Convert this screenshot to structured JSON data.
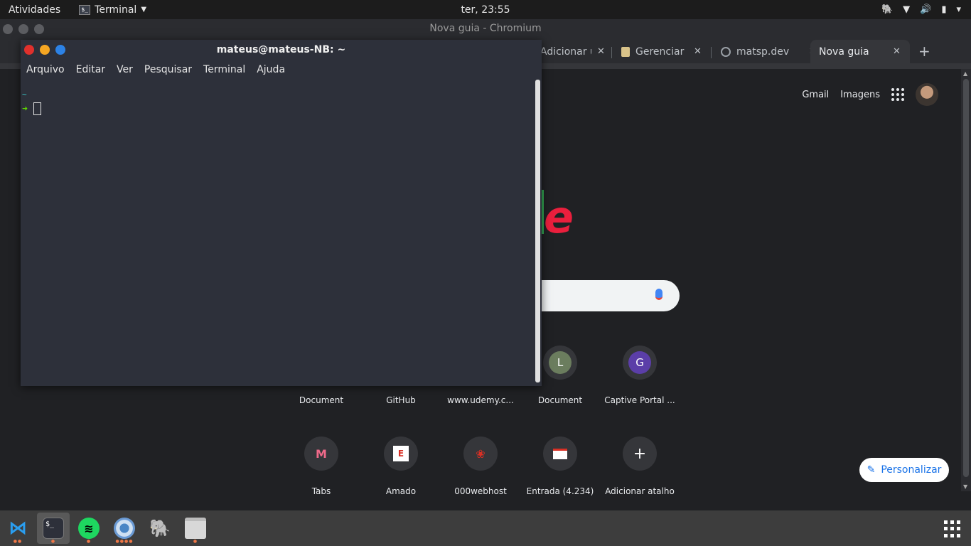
{
  "topbar": {
    "activities": "Atividades",
    "app_menu": "Terminal",
    "clock": "ter, 23:55"
  },
  "browser": {
    "window_title": "Nova guia - Chromium",
    "tabs": [
      {
        "label": "Adicionar u"
      },
      {
        "label": "Gerenciar D"
      },
      {
        "label": "matsp.dev"
      },
      {
        "label": "Nova guia"
      }
    ],
    "header_links": {
      "gmail": "Gmail",
      "images": "Imagens"
    },
    "shortcuts_row1": [
      {
        "label": "Document"
      },
      {
        "label": "GitHub"
      },
      {
        "label": "www.udemy.c..."
      },
      {
        "label": "Document",
        "letter": "L",
        "color": "#6b7d5e"
      },
      {
        "label": "Captive Portal ...",
        "letter": "G",
        "color": "#5b3ea8"
      }
    ],
    "shortcuts_row2": [
      {
        "label": "Tabs",
        "icon": "m-logo-icon"
      },
      {
        "label": "Amado",
        "letter": "E"
      },
      {
        "label": "000webhost",
        "icon": "webhost-icon"
      },
      {
        "label": "Entrada (4.234)",
        "icon": "gmail-icon"
      },
      {
        "label": "Adicionar atalho",
        "icon": "plus-icon"
      }
    ],
    "customize": "Personalizar",
    "colors": {
      "accent": "#1a73e8",
      "logo_red": "#ea1f3d"
    }
  },
  "terminal": {
    "title": "mateus@mateus-NB: ~",
    "menu": [
      "Arquivo",
      "Editar",
      "Ver",
      "Pesquisar",
      "Terminal",
      "Ajuda"
    ],
    "prompt_dir": "~",
    "prompt_arrow": "➜"
  },
  "dock": {
    "items": [
      "vscode-icon",
      "terminal-icon",
      "spotify-icon",
      "chromium-icon",
      "postgres-icon",
      "files-icon"
    ]
  }
}
